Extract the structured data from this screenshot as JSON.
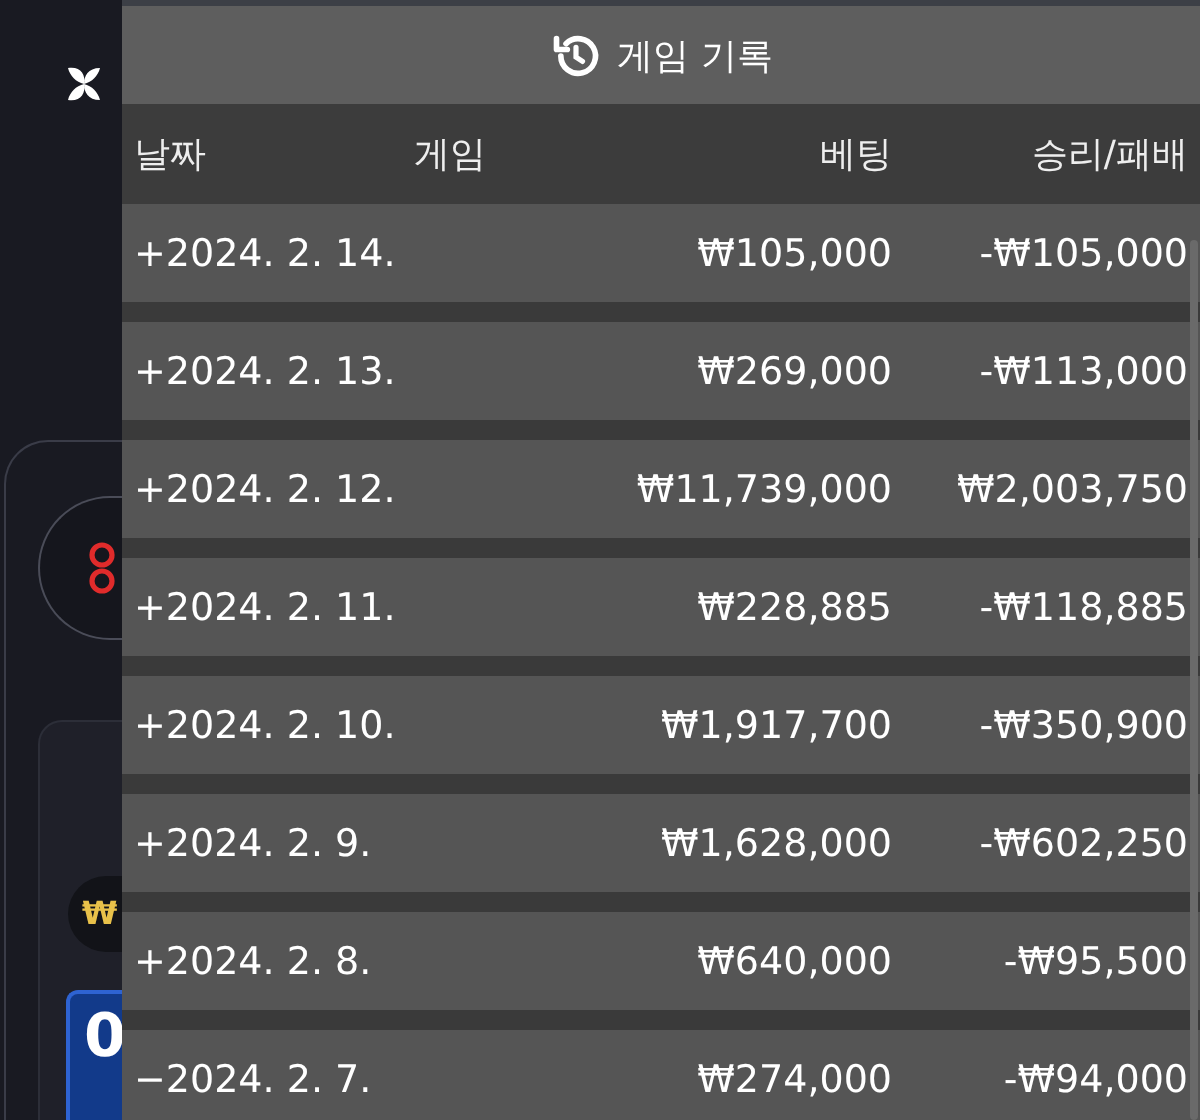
{
  "background": {
    "currency_symbol": "₩",
    "amount": "0"
  },
  "panel": {
    "title": "게임 기록"
  },
  "table": {
    "columns": [
      "날짜",
      "게임",
      "베팅",
      "승리/패배"
    ],
    "rows": [
      {
        "date": "+2024. 2. 14.",
        "bet": "₩105,000",
        "result": "-₩105,000"
      },
      {
        "date": "+2024. 2. 13.",
        "bet": "₩269,000",
        "result": "-₩113,000"
      },
      {
        "date": "+2024. 2. 12.",
        "bet": "₩11,739,000",
        "result": "₩2,003,750"
      },
      {
        "date": "+2024. 2. 11.",
        "bet": "₩228,885",
        "result": "-₩118,885"
      },
      {
        "date": "+2024. 2. 10.",
        "bet": "₩1,917,700",
        "result": "-₩350,900"
      },
      {
        "date": "+2024. 2. 9.",
        "bet": "₩1,628,000",
        "result": "-₩602,250"
      },
      {
        "date": "+2024. 2. 8.",
        "bet": "₩640,000",
        "result": "-₩95,500"
      },
      {
        "date": "−2024. 2. 7.",
        "bet": "₩274,000",
        "result": "-₩94,000"
      }
    ]
  }
}
